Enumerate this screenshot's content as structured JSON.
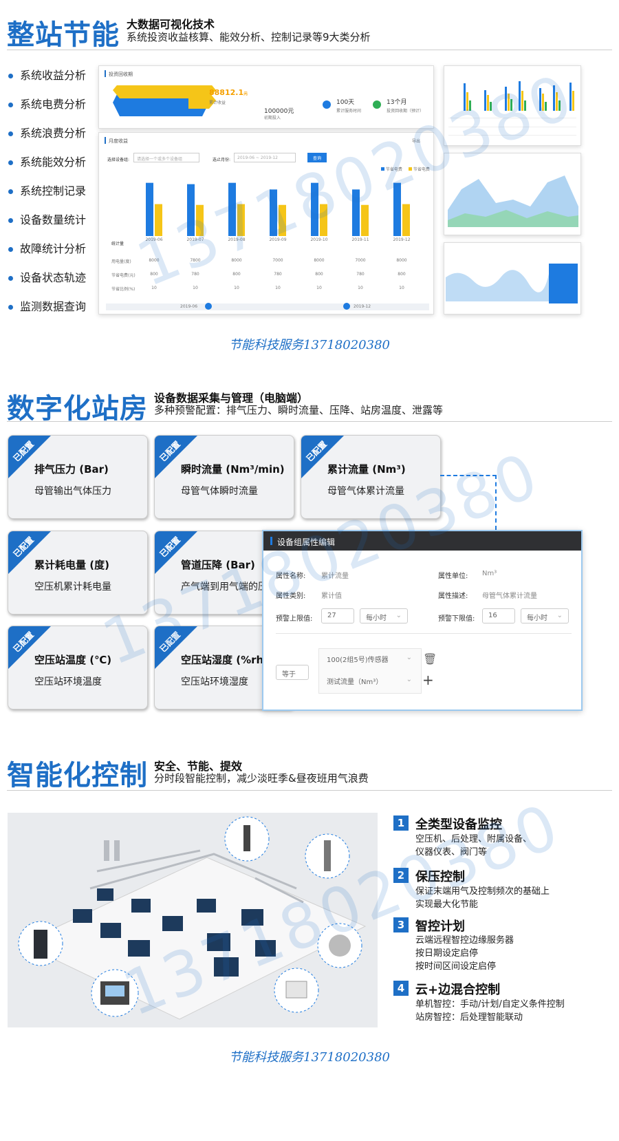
{
  "section1": {
    "title": "整站节能",
    "subtitle": "大数据可视化技术",
    "desc": "系统投资收益核算、能效分析、控制记录等9大类分析",
    "features": [
      "系统收益分析",
      "系统电费分析",
      "系统浪费分析",
      "系统能效分析",
      "系统控制记录",
      "设备数量统计",
      "故障统计分析",
      "设备状态轨迹",
      "监测数据查询"
    ],
    "dashboard": {
      "roi_title": "投资回收期",
      "cumulative_value": "88812.1",
      "cumulative_unit": "元",
      "cumulative_label": "累计收益",
      "invest_value": "100000元",
      "invest_label": "初期投入",
      "days_value": "100天",
      "days_label": "累计服务时间",
      "months_value": "13个月",
      "months_label": "投资回收期（预计）",
      "monthly_title": "月度收益",
      "export_label": "导出",
      "select_device_label": "选择设备组:",
      "select_device_placeholder": "请选择一个或多个设备组",
      "month_label": "选止月份:",
      "month_range": "2019-06 ~ 2019-12",
      "query_button": "查询",
      "legend_power": "节省电费",
      "legend_save": "节省电费",
      "table_head": "统计量",
      "row_labels": [
        "用电量(度)",
        "节省电费(元)",
        "节省比例(%)"
      ],
      "slider_start": "2019-06",
      "slider_end": "2019-12"
    },
    "chart_data": {
      "type": "bar",
      "categories": [
        "2019-06",
        "2019-07",
        "2019-08",
        "2019-09",
        "2019-10",
        "2019-11",
        "2019-12"
      ],
      "series": [
        {
          "name": "节省电费",
          "values": [
            8000,
            7800,
            8000,
            7000,
            8000,
            7000,
            8000
          ],
          "color": "#1e7be0"
        },
        {
          "name": "节省电费",
          "values": [
            800,
            780,
            800,
            780,
            800,
            780,
            800
          ],
          "color": "#f5c518"
        }
      ],
      "ratio": [
        10,
        10,
        10,
        10,
        10,
        10,
        10
      ]
    },
    "service": "节能科技服务13718020380"
  },
  "section2": {
    "title": "数字化站房",
    "subtitle": "设备数据采集与管理（电脑端）",
    "desc": "多种预警配置：排气压力、瞬时流量、压降、站房温度、泄露等",
    "badge": "已配置",
    "cards": [
      {
        "title": "排气压力 (Bar)",
        "desc": "母管输出气体压力"
      },
      {
        "title": "瞬时流量 (Nm³/min)",
        "desc": "母管气体瞬时流量"
      },
      {
        "title": "累计流量 (Nm³)",
        "desc": "母管气体累计流量"
      },
      {
        "title": "累计耗电量 (度)",
        "desc": "空压机累计耗电量"
      },
      {
        "title": "管道压降 (Bar)",
        "desc": "产气端到用气端的压"
      },
      {
        "title": "空压站温度 (℃)",
        "desc": "空压站环境温度"
      },
      {
        "title": "空压站湿度 (%rh)",
        "desc": "空压站环境湿度"
      }
    ],
    "dialog": {
      "title": "设备组属性编辑",
      "name_label": "属性名称:",
      "name_value": "累计流量",
      "unit_label": "属性单位:",
      "unit_value": "Nm³",
      "type_label": "属性类别:",
      "type_value": "累计值",
      "desc_label": "属性描述:",
      "desc_value": "母管气体累计流量",
      "upper_label": "预警上限值:",
      "upper_value": "27",
      "upper_period": "每小时",
      "lower_label": "预警下限值:",
      "lower_value": "16",
      "lower_period": "每小时",
      "condition": "等于",
      "sensor": "100(2组5号)传感器",
      "metric": "测试流量（Nm³）"
    }
  },
  "section3": {
    "title": "智能化控制",
    "subtitle": "安全、节能、提效",
    "desc": "分时段智能控制，减少淡旺季&昼夜班用气浪费",
    "steps": [
      {
        "num": "1",
        "title": "全类型设备监控",
        "lines": [
          "空压机、后处理、附属设备、",
          "仪器仪表、阀门等"
        ]
      },
      {
        "num": "2",
        "title": "保压控制",
        "lines": [
          "保证末端用气及控制频次的基础上",
          "实现最大化节能"
        ]
      },
      {
        "num": "3",
        "title": "智控计划",
        "lines": [
          "云端远程智控边缘服务器",
          "按日期设定启停",
          "按时间区间设定启停"
        ]
      },
      {
        "num": "4",
        "title": "云+边混合控制",
        "lines": [
          "单机智控：手动/计划/自定义条件控制",
          "站房智控：后处理智能联动"
        ]
      }
    ],
    "service": "节能科技服务13718020380"
  },
  "watermark": "13718020380"
}
